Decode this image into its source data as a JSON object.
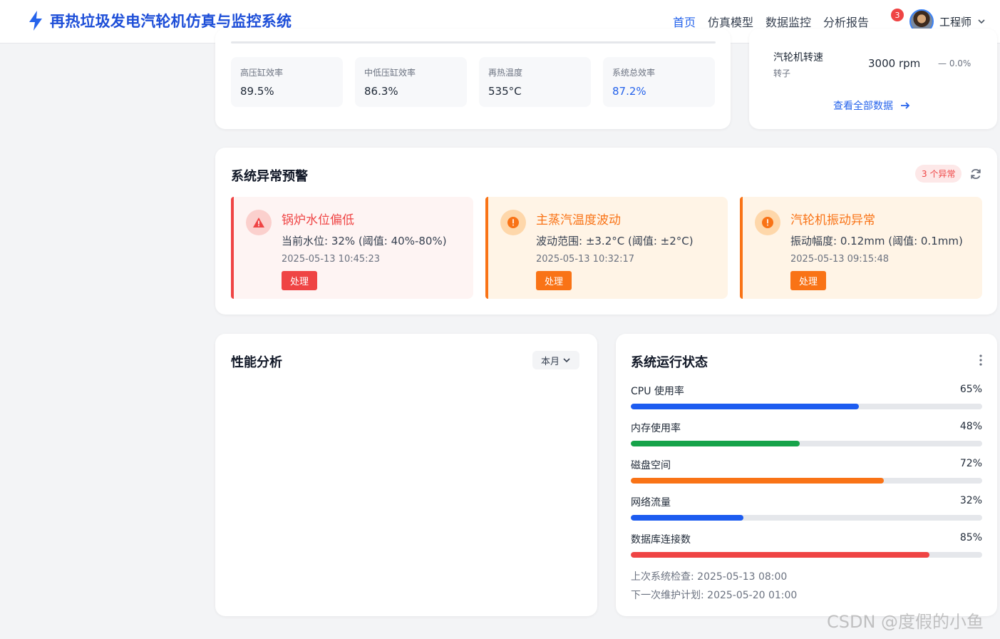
{
  "header": {
    "title": "再热垃圾发电汽轮机仿真与监控系统",
    "nav": [
      "首页",
      "仿真模型",
      "数据监控",
      "分析报告"
    ],
    "notifications": "3",
    "user": "工程师"
  },
  "metrics": [
    {
      "label": "高压缸效率",
      "value": "89.5%"
    },
    {
      "label": "中低压缸效率",
      "value": "86.3%"
    },
    {
      "label": "再热温度",
      "value": "535°C"
    },
    {
      "label": "系统总效率",
      "value": "87.2%"
    }
  ],
  "turbine": {
    "name": "汽轮机转速",
    "sub": "转子",
    "value": "3000 rpm",
    "change": "— 0.0%",
    "view_all": "查看全部数据"
  },
  "alerts": {
    "title": "系统异常预警",
    "count": "3 个异常",
    "items": [
      {
        "title": "锅炉水位偏低",
        "desc": "当前水位: 32% (阈值: 40%-80%)",
        "time": "2025-05-13 10:45:23",
        "action": "处理",
        "color": "#ef4444"
      },
      {
        "title": "主蒸汽温度波动",
        "desc": "波动范围: ±3.2°C (阈值: ±2°C)",
        "time": "2025-05-13 10:32:17",
        "action": "处理",
        "color": "#f97316"
      },
      {
        "title": "汽轮机振动异常",
        "desc": "振动幅度: 0.12mm (阈值: 0.1mm)",
        "time": "2025-05-13 09:15:48",
        "action": "处理",
        "color": "#f97316"
      }
    ]
  },
  "performance": {
    "title": "性能分析",
    "period": "本月"
  },
  "status": {
    "title": "系统运行状态",
    "items": [
      {
        "label": "CPU 使用率",
        "value": "65%",
        "percent": 65,
        "color": "#1d5cf0"
      },
      {
        "label": "内存使用率",
        "value": "48%",
        "percent": 48,
        "color": "#16a34a"
      },
      {
        "label": "磁盘空间",
        "value": "72%",
        "percent": 72,
        "color": "#f97316"
      },
      {
        "label": "网络流量",
        "value": "32%",
        "percent": 32,
        "color": "#1d5cf0"
      },
      {
        "label": "数据库连接数",
        "value": "85%",
        "percent": 85,
        "color": "#ef4444"
      }
    ],
    "last_check": "上次系统检查: 2025-05-13 08:00",
    "next_maintenance": "下一次维护计划: 2025-05-20 01:00"
  },
  "watermark": "CSDN @度假的小鱼"
}
